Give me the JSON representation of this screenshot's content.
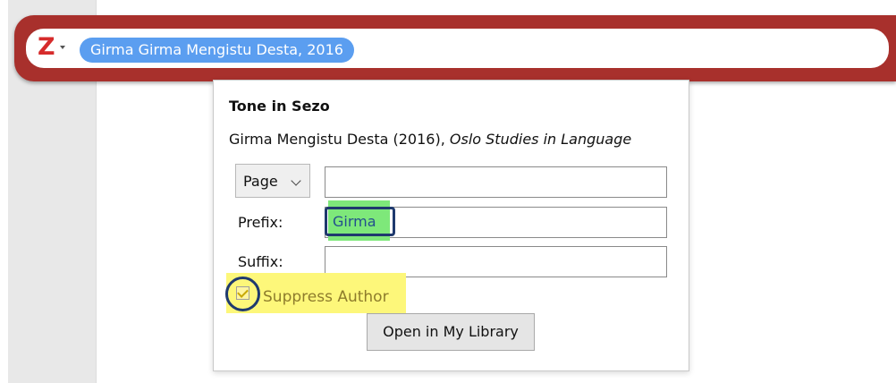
{
  "toolbar": {
    "logo_letter": "Z",
    "citation_bubble": "Girma Girma Mengistu Desta, 2016"
  },
  "panel": {
    "title": "Tone in Sezo",
    "citation_prefix": "Girma Mengistu Desta (2016), ",
    "citation_journal": "Oslo Studies in Language",
    "locator": {
      "selected": "Page",
      "value": ""
    },
    "prefix": {
      "label": "Prefix:",
      "value": "Girma"
    },
    "suffix": {
      "label": "Suffix:",
      "value": ""
    },
    "suppress_author": {
      "label": "Suppress Author",
      "checked": true
    },
    "open_button": "Open in My Library"
  },
  "colors": {
    "toolbar_frame": "#a8302c",
    "bubble": "#5b9ef0",
    "logo": "#d62b2b",
    "green_highlight": "#7ee87a",
    "yellow_highlight": "#fdf77a",
    "annotation_outline": "#1f3a6e"
  },
  "icons": {
    "logo": "zotero-z-icon",
    "logo_menu": "chevron-down-icon",
    "locator_dropdown": "chevron-down-icon",
    "checkbox": "checkmark-icon"
  }
}
